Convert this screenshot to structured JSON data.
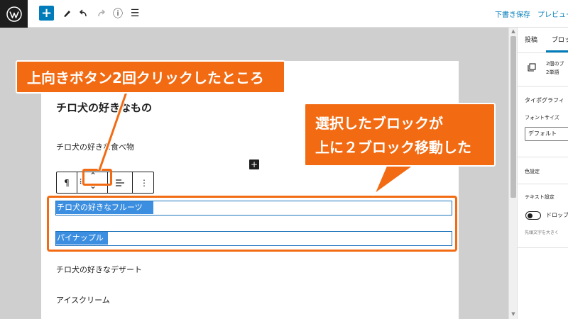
{
  "toolbar": {
    "save_draft": "下書き保存",
    "preview": "プレビュー",
    "add_symbol": "+",
    "info_symbol": "ⓘ",
    "list_view_symbol": "☰"
  },
  "editor": {
    "post_title": "チロ犬の好きなもの",
    "paragraphs": [
      "チロ犬の好きな食べ物",
      "チロ犬の好きなフルーツ",
      "パイナップル",
      "チロ犬の好きなデザート",
      "アイスクリーム"
    ],
    "inserter_symbol": "+",
    "block_toolbar": {
      "paragraph_symbol": "¶",
      "drag_symbol": "⠿",
      "move_up_symbol": "⌃",
      "move_down_symbol": "⌄",
      "more_symbol": "⋮"
    }
  },
  "annotations": {
    "callout_top": "上向きボタン2回クリックしたところ",
    "callout_right_line1": "選択したブロックが",
    "callout_right_line2": "上に２ブロック移動した",
    "accent_color": "#f26b13"
  },
  "sidebar": {
    "tab_post": "投稿",
    "tab_block": "ブロック",
    "block_info_line1": "2個のブ",
    "block_info_line2": "2単語",
    "typography_heading": "タイポグラフィ",
    "font_size_label": "フォントサイズ",
    "font_size_value": "デフォルト",
    "color_settings": "色設定",
    "text_settings": "テキスト設定",
    "drop_cap_label": "ドロップ",
    "drop_cap_help": "先頭文字を大きく"
  },
  "colors": {
    "wp_blue": "#007cba",
    "selection_blue": "#3c8fe0",
    "canvas_gray": "#cfcfcf"
  }
}
